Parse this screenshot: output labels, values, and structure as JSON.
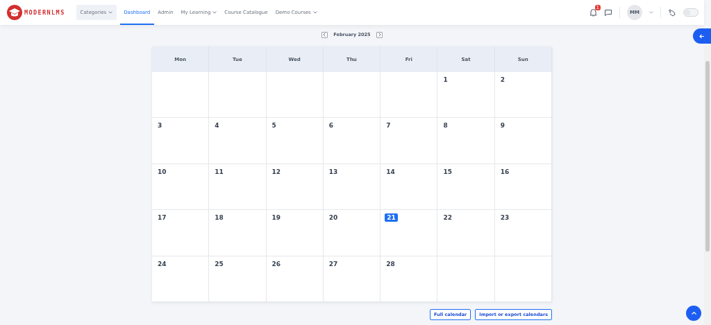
{
  "logo": {
    "text": "MODERNLMS"
  },
  "nav": [
    {
      "label": "Categories",
      "dropdown": true,
      "selected": false,
      "boxed": true
    },
    {
      "label": "Dashboard",
      "dropdown": false,
      "selected": true,
      "boxed": false
    },
    {
      "label": "Admin",
      "dropdown": false,
      "selected": false,
      "boxed": false
    },
    {
      "label": "My Learning",
      "dropdown": true,
      "selected": false,
      "boxed": false
    },
    {
      "label": "Course Catalogue",
      "dropdown": false,
      "selected": false,
      "boxed": false
    },
    {
      "label": "Demo Courses",
      "dropdown": true,
      "selected": false,
      "boxed": false
    }
  ],
  "notifications": {
    "count": "1"
  },
  "user": {
    "initials": "MM"
  },
  "theme_toggle": {
    "on": false
  },
  "calendar": {
    "month": "February 2025",
    "weekdays": [
      "Mon",
      "Tue",
      "Wed",
      "Thu",
      "Fri",
      "Sat",
      "Sun"
    ],
    "weeks": [
      [
        {
          "kind": "blank"
        },
        {
          "kind": "blank"
        },
        {
          "kind": "blank"
        },
        {
          "kind": "blank"
        },
        {
          "kind": "blank"
        },
        {
          "kind": "day",
          "day": "1",
          "today": false
        },
        {
          "kind": "day",
          "day": "2",
          "today": false
        }
      ],
      [
        {
          "kind": "day",
          "day": "3",
          "today": false
        },
        {
          "kind": "day",
          "day": "4",
          "today": false
        },
        {
          "kind": "day",
          "day": "5",
          "today": false
        },
        {
          "kind": "day",
          "day": "6",
          "today": false
        },
        {
          "kind": "day",
          "day": "7",
          "today": false
        },
        {
          "kind": "day",
          "day": "8",
          "today": false
        },
        {
          "kind": "day",
          "day": "9",
          "today": false
        }
      ],
      [
        {
          "kind": "day",
          "day": "10",
          "today": false
        },
        {
          "kind": "day",
          "day": "11",
          "today": false
        },
        {
          "kind": "day",
          "day": "12",
          "today": false
        },
        {
          "kind": "day",
          "day": "13",
          "today": false
        },
        {
          "kind": "day",
          "day": "14",
          "today": false
        },
        {
          "kind": "day",
          "day": "15",
          "today": false
        },
        {
          "kind": "day",
          "day": "16",
          "today": false
        }
      ],
      [
        {
          "kind": "day",
          "day": "17",
          "today": false
        },
        {
          "kind": "day",
          "day": "18",
          "today": false
        },
        {
          "kind": "day",
          "day": "19",
          "today": false
        },
        {
          "kind": "day",
          "day": "20",
          "today": false
        },
        {
          "kind": "day",
          "day": "21",
          "today": true
        },
        {
          "kind": "day",
          "day": "22",
          "today": false
        },
        {
          "kind": "day",
          "day": "23",
          "today": false
        }
      ],
      [
        {
          "kind": "day",
          "day": "24",
          "today": false
        },
        {
          "kind": "day",
          "day": "25",
          "today": false
        },
        {
          "kind": "day",
          "day": "26",
          "today": false
        },
        {
          "kind": "day",
          "day": "27",
          "today": false
        },
        {
          "kind": "day",
          "day": "28",
          "today": false
        },
        {
          "kind": "blank"
        },
        {
          "kind": "blank"
        }
      ]
    ]
  },
  "buttons": [
    "Full calendar",
    "Import or export calendars"
  ]
}
